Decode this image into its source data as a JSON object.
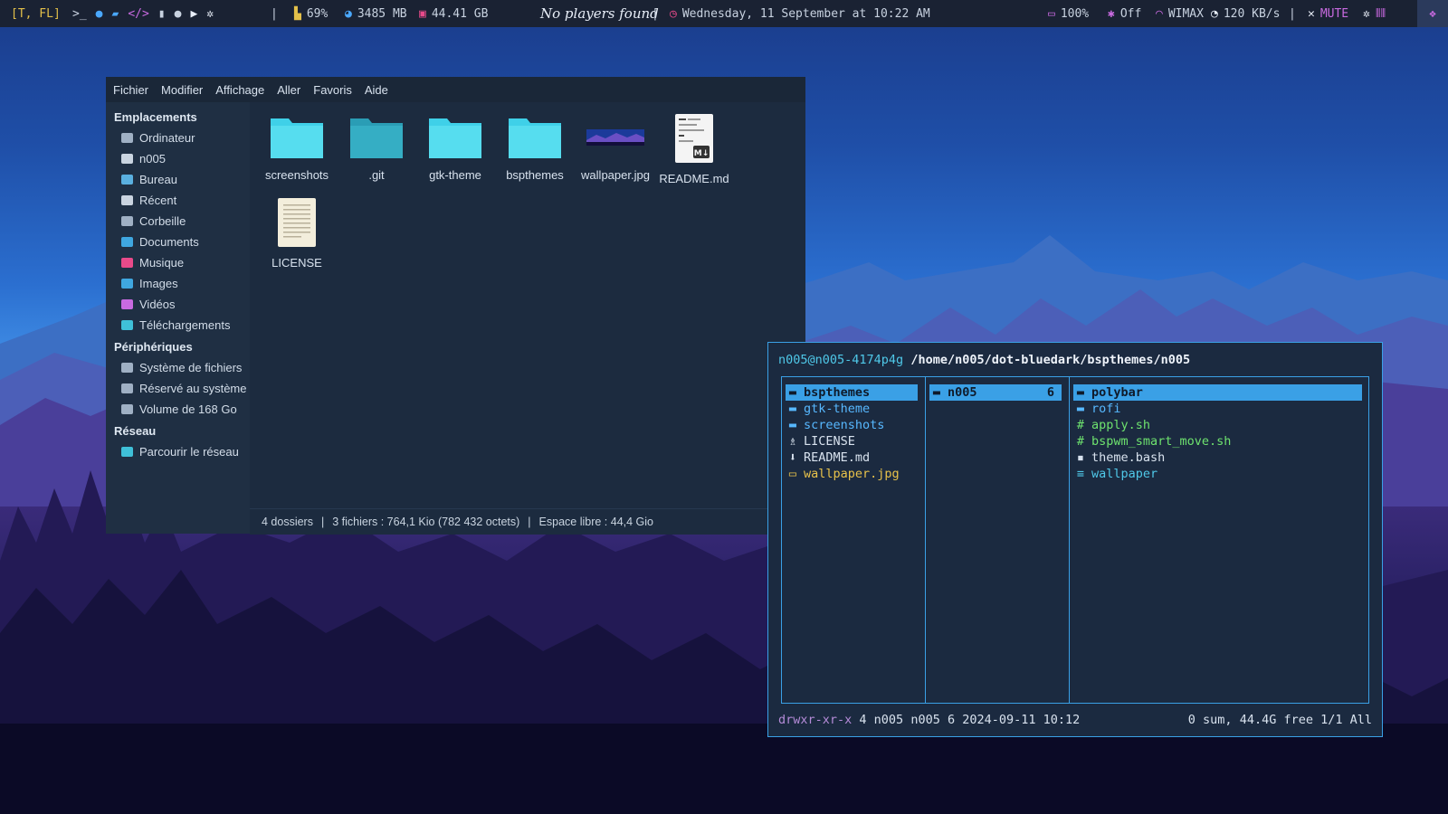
{
  "topbar": {
    "workspace": "[T, FL]",
    "cpu": "69%",
    "ram": "3485 MB",
    "disk": "44.41 GB",
    "media": "No players found",
    "sep": "|",
    "datetime": "Wednesday, 11 September at 10:22 AM",
    "battery": "100%",
    "bluetooth": "Off",
    "network": "WIMAX",
    "speed": "120 KB/s",
    "volume": "MUTE"
  },
  "filemanager": {
    "menu": [
      "Fichier",
      "Modifier",
      "Affichage",
      "Aller",
      "Favoris",
      "Aide"
    ],
    "sidebar": {
      "places_header": "Emplacements",
      "places": [
        {
          "label": "Ordinateur",
          "color": "#9fb0c4"
        },
        {
          "label": "n005",
          "color": "#c9d4e0"
        },
        {
          "label": "Bureau",
          "color": "#5ab0e0"
        },
        {
          "label": "Récent",
          "color": "#c9d4e0"
        },
        {
          "label": "Corbeille",
          "color": "#9fb0c4"
        },
        {
          "label": "Documents",
          "color": "#3fa7e0"
        },
        {
          "label": "Musique",
          "color": "#e84a8a"
        },
        {
          "label": "Images",
          "color": "#3fa7e0"
        },
        {
          "label": "Vidéos",
          "color": "#c86ae0"
        },
        {
          "label": "Téléchargements",
          "color": "#3fc0d8"
        }
      ],
      "devices_header": "Périphériques",
      "devices": [
        {
          "label": "Système de fichiers",
          "color": "#9fb0c4"
        },
        {
          "label": "Réservé au système",
          "color": "#9fb0c4"
        },
        {
          "label": "Volume de 168 Go",
          "color": "#9fb0c4"
        }
      ],
      "network_header": "Réseau",
      "network": [
        {
          "label": "Parcourir le réseau",
          "color": "#3fc0d8"
        }
      ]
    },
    "files": [
      "screenshots",
      ".git",
      "gtk-theme",
      "bspthemes",
      "wallpaper.jpg",
      "README.md",
      "LICENSE"
    ],
    "status": {
      "folders": "4 dossiers",
      "files": "3 fichiers : 764,1 Kio (782 432 octets)",
      "free": "Espace libre : 44,4 Gio",
      "sep": "|"
    }
  },
  "ranger": {
    "user": "n005@n005-4174p4g",
    "path": "/home/n005/dot-bluedark/bspthemes/n005",
    "col1": [
      {
        "name": "bspthemes",
        "icon": "folder-icon"
      },
      {
        "name": "gtk-theme",
        "icon": "folder-icon"
      },
      {
        "name": "screenshots",
        "icon": "folder-icon"
      },
      {
        "name": "LICENSE",
        "icon": "license-icon"
      },
      {
        "name": "README.md",
        "icon": "download-icon"
      },
      {
        "name": "wallpaper.jpg",
        "icon": "image-icon"
      }
    ],
    "col2": [
      {
        "name": "n005",
        "count": "6"
      }
    ],
    "col3": [
      {
        "name": "polybar",
        "icon": "folder-icon"
      },
      {
        "name": "rofi",
        "icon": "folder-icon"
      },
      {
        "name": "apply.sh",
        "icon": "hash-icon"
      },
      {
        "name": "bspwm_smart_move.sh",
        "icon": "hash-icon"
      },
      {
        "name": "theme.bash",
        "icon": "terminal-icon"
      },
      {
        "name": "wallpaper",
        "icon": "text-icon"
      }
    ],
    "status": {
      "perm": "drwxr-xr-x",
      "info": "4 n005 n005 6 2024-09-11 10:12",
      "right": "0 sum, 44.4G free  1/1  All"
    }
  }
}
